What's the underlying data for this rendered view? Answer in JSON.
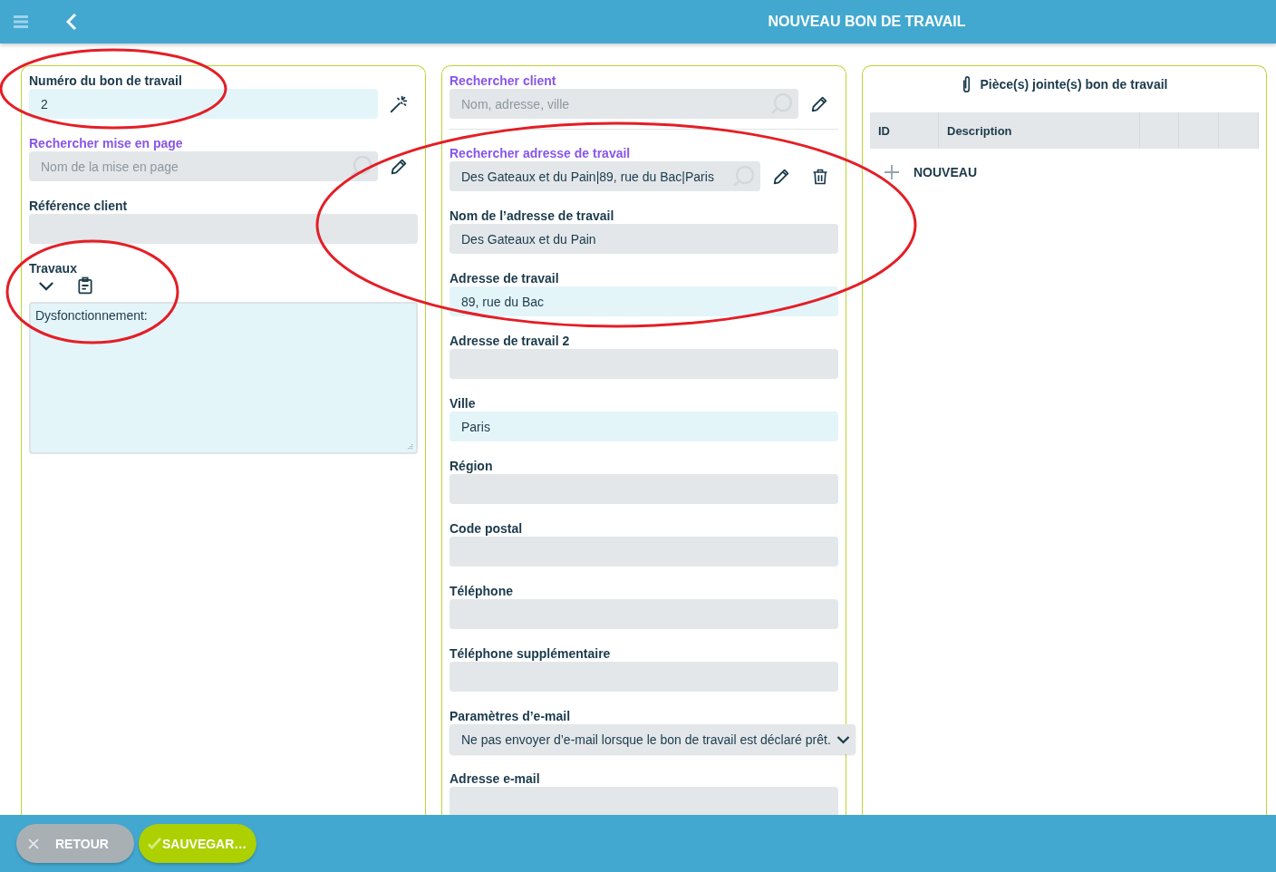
{
  "header": {
    "title": "NOUVEAU BON DE TRAVAIL"
  },
  "columns": [
    {
      "fields": [
        {
          "kind": "text",
          "label": "Numéro du bon de travail",
          "value": "2",
          "highlighted": true,
          "actions": [
            {
              "kind": "generate"
            }
          ]
        },
        {
          "kind": "search",
          "label": "Rechercher mise en page",
          "placeholder": "Nom de la mise en page",
          "highlighted": false,
          "actions": [
            {
              "kind": "edit"
            }
          ]
        },
        {
          "kind": "text",
          "label": "Référence client",
          "highlighted": false
        },
        {
          "kind": "textarea",
          "label": "Travaux",
          "value": "Dysfonctionnement:",
          "highlighted": true,
          "tools": [
            {
              "kind": "expand"
            },
            {
              "kind": "template"
            }
          ]
        }
      ]
    },
    {
      "fields": [
        {
          "kind": "search",
          "label": "Rechercher client",
          "placeholder": "Nom, adresse, ville",
          "highlighted": false,
          "actions": [
            {
              "kind": "edit"
            }
          ]
        },
        {
          "kind": "divider"
        },
        {
          "kind": "search",
          "label": "Rechercher adresse de travail",
          "value": "Des Gateaux et du Pain|89, rue du Bac|Paris",
          "highlighted": false,
          "actions": [
            {
              "kind": "edit"
            },
            {
              "kind": "delete"
            }
          ]
        },
        {
          "kind": "text",
          "label": "Nom de l’adresse de travail",
          "value": "Des Gateaux et du Pain",
          "highlighted": false
        },
        {
          "kind": "text",
          "label": "Adresse de travail",
          "value": "89, rue du Bac",
          "highlighted": true
        },
        {
          "kind": "text",
          "label": "Adresse de travail 2",
          "highlighted": false
        },
        {
          "kind": "text",
          "label": "Ville",
          "value": "Paris",
          "highlighted": true
        },
        {
          "kind": "text",
          "label": "Région",
          "highlighted": false
        },
        {
          "kind": "text",
          "label": "Code postal",
          "highlighted": false
        },
        {
          "kind": "text",
          "label": "Téléphone",
          "highlighted": false
        },
        {
          "kind": "text",
          "label": "Téléphone supplémentaire",
          "highlighted": false
        },
        {
          "kind": "select",
          "label": "Paramètres d’e-mail",
          "value": "Ne pas envoyer d’e-mail lorsque le bon de travail est déclaré prêt.",
          "highlighted": false
        },
        {
          "kind": "text",
          "label": "Adresse e-mail",
          "highlighted": false
        }
      ]
    }
  ],
  "attachments": {
    "title": "Pièce(s) jointe(s) bon de travail",
    "columns": [
      {
        "kind": "label",
        "label": "ID"
      },
      {
        "kind": "label",
        "label": "Description"
      },
      {
        "kind": "blank"
      },
      {
        "kind": "blank"
      },
      {
        "kind": "blank"
      }
    ],
    "new_button": "NOUVEAU"
  },
  "footer": {
    "buttons": [
      {
        "kind": "cancel",
        "label": "RETOUR"
      },
      {
        "kind": "save",
        "label": "SAUVEGAR…"
      }
    ]
  }
}
